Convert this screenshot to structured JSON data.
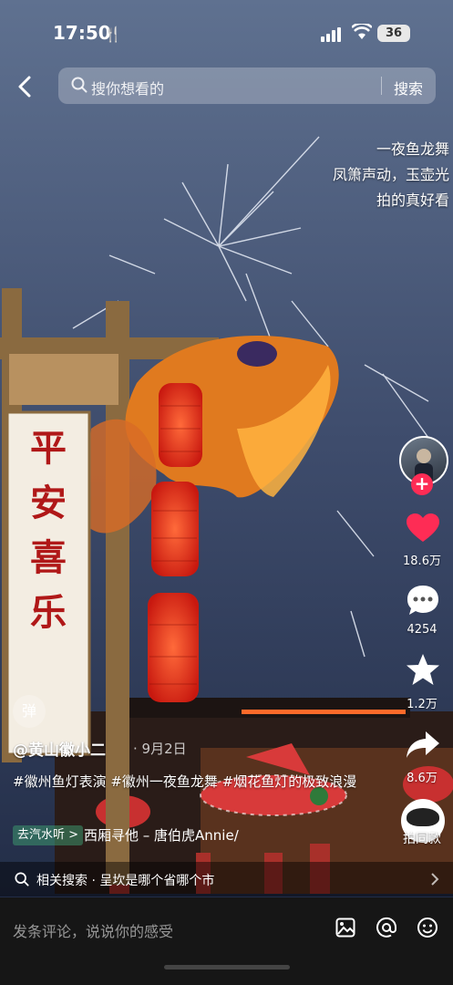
{
  "status_bar": {
    "time": "17:50",
    "battery": "36"
  },
  "search": {
    "placeholder": "搜你想看的",
    "button_label": "搜索"
  },
  "caption_lines": [
    "一夜鱼龙舞",
    "凤箫声动，玉壶光",
    "拍的真好看"
  ],
  "sign_text": [
    "平",
    "安",
    "喜",
    "乐"
  ],
  "side_actions": {
    "likes": "18.6万",
    "comments": "4254",
    "favorites": "1.2万",
    "shares": "8.6万",
    "same_style": "拍同款"
  },
  "video": {
    "danmu_label": "弹",
    "author": "@黄山徽小二",
    "date": "· 9月2日",
    "description": "#徽州鱼灯表演 #徽州一夜鱼龙舞 #烟花鱼灯的极致浪漫",
    "music_tag": "去汽水听 >",
    "music": "西厢寻他 – 唐伯虎Annie/"
  },
  "related_search": {
    "text": "相关搜索 · 呈坎是哪个省哪个市"
  },
  "comment": {
    "placeholder": "发条评论，说说你的感受"
  },
  "colors": {
    "like_red": "#fe2c55",
    "sky_top": "#4c5f80",
    "sky_bottom": "#1e2a48",
    "lantern": "#e8261a"
  }
}
